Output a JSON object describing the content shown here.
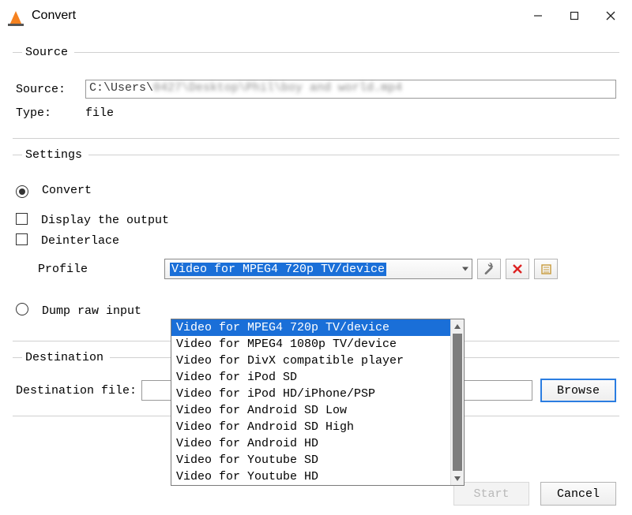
{
  "window": {
    "title": "Convert"
  },
  "source": {
    "legend": "Source",
    "label": "Source:",
    "path_visible": "C:\\Users\\",
    "path_blurred": "0427\\Desktop\\Phil\\boy and world.mp4",
    "type_label": "Type:",
    "type_value": "file"
  },
  "settings": {
    "legend": "Settings",
    "convert_label": "Convert",
    "display_output_label": "Display the output",
    "deinterlace_label": "Deinterlace",
    "profile_label": "Profile",
    "profile_selected": "Video for MPEG4 720p TV/device",
    "profile_options": [
      "Video for MPEG4 720p TV/device",
      "Video for MPEG4 1080p TV/device",
      "Video for DivX compatible player",
      "Video for iPod SD",
      "Video for iPod HD/iPhone/PSP",
      "Video for Android SD Low",
      "Video for Android SD High",
      "Video for Android HD",
      "Video for Youtube SD",
      "Video for Youtube HD"
    ],
    "dump_raw_label": "Dump raw input"
  },
  "destination": {
    "legend": "Destination",
    "label": "Destination file:",
    "browse_label": "Browse"
  },
  "footer": {
    "start_label": "Start",
    "cancel_label": "Cancel"
  }
}
